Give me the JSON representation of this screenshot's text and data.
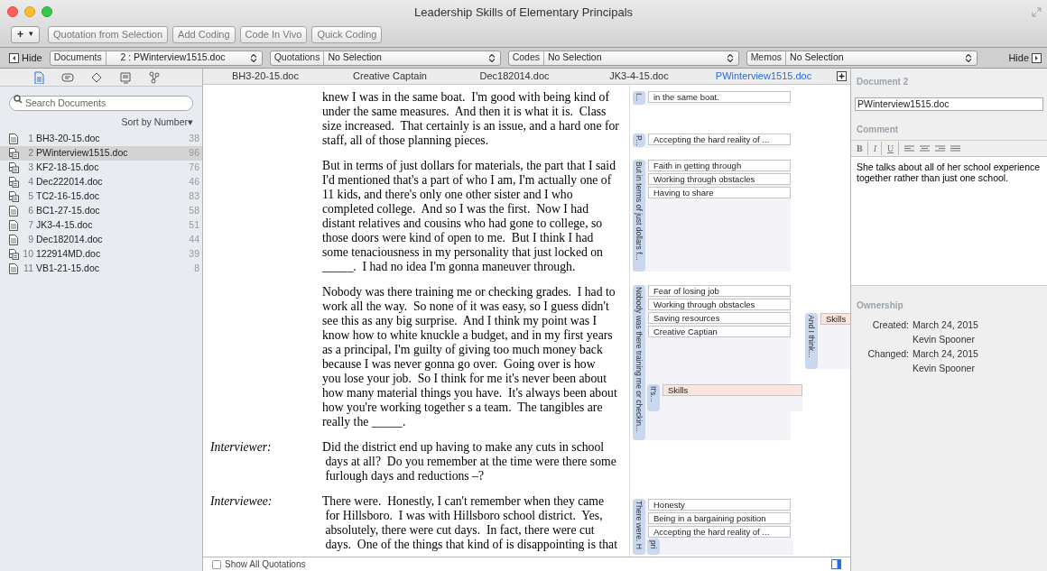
{
  "window": {
    "title": "Leadership Skills of Elementary Principals"
  },
  "toolbar": {
    "add_menu": {
      "plus": "+",
      "caret": "▾"
    },
    "buttons": [
      "Quotation from Selection",
      "Add Coding",
      "Code In Vivo",
      "Quick Coding"
    ]
  },
  "filter_bar": {
    "hide_left": "Hide",
    "documents": {
      "label": "Documents",
      "value": "2 : PWinterview1515.doc"
    },
    "quotations": {
      "label": "Quotations",
      "value": "No Selection"
    },
    "codes": {
      "label": "Codes",
      "value": "No Selection"
    },
    "memos": {
      "label": "Memos",
      "value": "No Selection"
    },
    "hide_right": "Hide"
  },
  "sidebar": {
    "view_icons": [
      {
        "kind": "document",
        "selected": true
      },
      {
        "kind": "quotation",
        "selected": false
      },
      {
        "kind": "code",
        "selected": false
      },
      {
        "kind": "memo",
        "selected": false
      },
      {
        "kind": "network",
        "selected": false
      }
    ],
    "search": {
      "placeholder": "Search Documents"
    },
    "sort": "Sort by Number▾",
    "documents": [
      {
        "number": "1",
        "name": "BH3-20-15.doc",
        "count": "38",
        "kind": "text",
        "selected": false
      },
      {
        "number": "2",
        "name": "PWinterview1515.doc",
        "count": "96",
        "kind": "linked",
        "selected": true
      },
      {
        "number": "3",
        "name": "KF2-18-15.doc",
        "count": "76",
        "kind": "linked",
        "selected": false
      },
      {
        "number": "4",
        "name": "Dec222014.doc",
        "count": "46",
        "kind": "linked",
        "selected": false
      },
      {
        "number": "5",
        "name": "TC2-16-15.doc",
        "count": "83",
        "kind": "linked",
        "selected": false
      },
      {
        "number": "6",
        "name": "BC1-27-15.doc",
        "count": "58",
        "kind": "text",
        "selected": false
      },
      {
        "number": "7",
        "name": "JK3-4-15.doc",
        "count": "51",
        "kind": "text",
        "selected": false
      },
      {
        "number": "9",
        "name": "Dec182014.doc",
        "count": "44",
        "kind": "text",
        "selected": false
      },
      {
        "number": "10",
        "name": "122914MD.doc",
        "count": "39",
        "kind": "linked",
        "selected": false
      },
      {
        "number": "11",
        "name": "VB1-21-15.doc",
        "count": "8",
        "kind": "text",
        "selected": false
      }
    ]
  },
  "tabs": [
    {
      "label": "BH3-20-15.doc",
      "selected": false
    },
    {
      "label": "Creative Captain",
      "selected": false
    },
    {
      "label": "Dec182014.doc",
      "selected": false
    },
    {
      "label": "JK3-4-15.doc",
      "selected": false
    },
    {
      "label": "PWinterview1515.doc",
      "selected": true
    }
  ],
  "document": {
    "paragraphs": [
      {
        "lines": [
          "knew I was in the same boat.  I'm good with being kind of",
          "under the same measures.  And then it is what it is.  Class",
          "size increased.  That certainly is an issue, and a hard one for",
          "staff, all of those planning pieces."
        ]
      },
      {
        "lines": [
          "But in terms of just dollars for materials, the part that I said",
          "I'd mentioned that's a part of who I am, I'm actually one of",
          "11 kids, and there's only one other sister and I who",
          "completed college.  And so I was the first.  Now I had",
          "distant relatives and cousins who had gone to college, so",
          "those doors were kind of open to me.  But I think I had",
          "some tenaciousness in my personality that just locked on",
          "_____.  I had no idea I'm gonna maneuver through."
        ]
      },
      {
        "lines": [
          "Nobody was there training me or checking grades.  I had to",
          "work all the way.  So none of it was easy, so I guess didn't",
          "see this as any big surprise.  And I think my point was I",
          "know how to white knuckle a budget, and in my first years",
          "as a principal, I'm guilty of giving too much money back",
          "because I was never gonna go over.  Going over is how",
          "you lose your job.  So I think for me it's never been about",
          "how many material things you have.  It's always been about",
          "how you're working together s a team.  The tangibles are",
          "really the _____."
        ]
      },
      {
        "speaker": "Interviewer:",
        "lines": [
          "Did the district end up having to make any cuts in school",
          " days at all?  Do you remember at the time were there some",
          " furlough days and reductions –?"
        ]
      },
      {
        "speaker": "Interviewee:",
        "lines": [
          "There were.  Honestly, I can't remember when they came",
          " for Hillsboro.  I was with Hillsboro school district.  Yes,",
          " absolutely, there were cut days.  In fact, there were cut",
          " days.  One of the things that kind of is disappointing is that"
        ]
      }
    ]
  },
  "margin": {
    "quotations": [
      {
        "label": "I...",
        "codes": [
          {
            "name": "in the same boat.",
            "color": "#ffffff"
          }
        ]
      },
      {
        "label": "P...",
        "codes": [
          {
            "name": "Accepting the hard reality of ...",
            "color": "#ffffff"
          }
        ]
      },
      {
        "label": "But in terms of just dollars f...",
        "codes": [
          {
            "name": "Faith in getting through",
            "color": "#ffffff"
          },
          {
            "name": "Working through obstacles",
            "color": "#ffffff"
          },
          {
            "name": "Having to share",
            "color": "#ffffff"
          }
        ]
      },
      {
        "label": "Nobody was there training me or checkin...",
        "codes": [
          {
            "name": "Fear of losing job",
            "color": "#ffffff"
          },
          {
            "name": "Working through obstacles",
            "color": "#ffffff"
          },
          {
            "name": "Saving resources",
            "color": "#ffffff"
          },
          {
            "name": "Creative Captian",
            "color": "#ffffff"
          }
        ]
      },
      {
        "label": "It's...",
        "codes": [
          {
            "name": "Skills",
            "color": "#fce4df"
          }
        ]
      },
      {
        "label": "And I think...",
        "codes": [
          {
            "name": "Skills",
            "color": "#fce4df"
          }
        ]
      },
      {
        "label": "There were.  H",
        "codes": [
          {
            "name": "Honesty",
            "color": "#ffffff"
          },
          {
            "name": "Being in a bargaining position",
            "color": "#ffffff"
          },
          {
            "name": "Accepting the hard reality of ...",
            "color": "#ffffff"
          }
        ]
      },
      {
        "label": "pri"
      }
    ]
  },
  "show_all_quotations": {
    "label": "Show All Quotations",
    "checked": false
  },
  "inspector": {
    "heading": "Document 2",
    "name_value": "PWinterview1515.doc",
    "comment_heading": "Comment",
    "format_buttons": [
      "B",
      "I",
      "U"
    ],
    "comment": "She talks about all of her school experience together rather than just one school.",
    "ownership_heading": "Ownership",
    "rows": [
      {
        "label": "Created:",
        "date": "March 24, 2015",
        "user": "Kevin Spooner"
      },
      {
        "label": "Changed:",
        "date": "March 24, 2015",
        "user": "Kevin Spooner"
      }
    ]
  }
}
